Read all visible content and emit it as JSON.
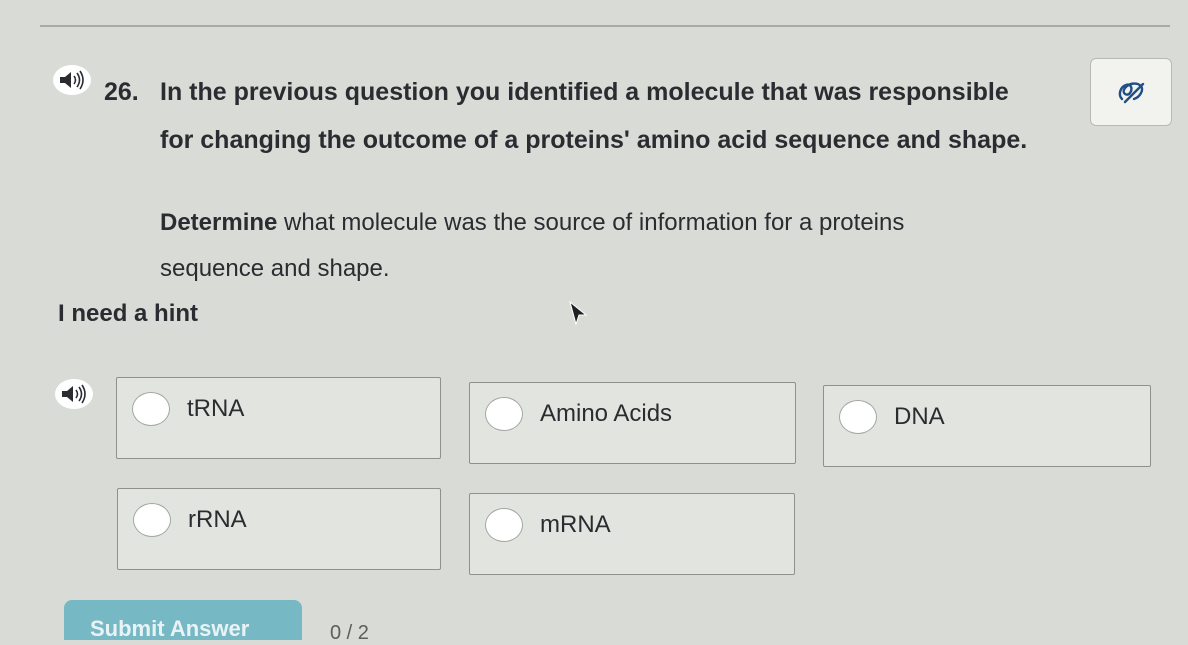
{
  "question": {
    "number": "26.",
    "line1": "In the previous question you identified a molecule that was responsible",
    "line2": "for changing the outcome of a proteins' amino acid sequence and shape."
  },
  "prompt": {
    "bold": "Determine",
    "rest_line1": " what molecule was the source of information for a proteins",
    "line2": "sequence and shape."
  },
  "hint_label": "I need a hint",
  "choices": [
    {
      "label": "tRNA"
    },
    {
      "label": "Amino Acids"
    },
    {
      "label": "DNA"
    },
    {
      "label": "rRNA"
    },
    {
      "label": "mRNA"
    }
  ],
  "submit_label": "Submit Answer",
  "progress_text": "0 / 2",
  "icons": {
    "question_audio": "speaker-icon",
    "answers_audio": "speaker-icon",
    "tool": "eraser-icon",
    "pointer": "mouse-pointer-icon"
  },
  "colors": {
    "background": "#d9dcd6",
    "submit": "#77b8c5",
    "text": "#2a2c31"
  }
}
